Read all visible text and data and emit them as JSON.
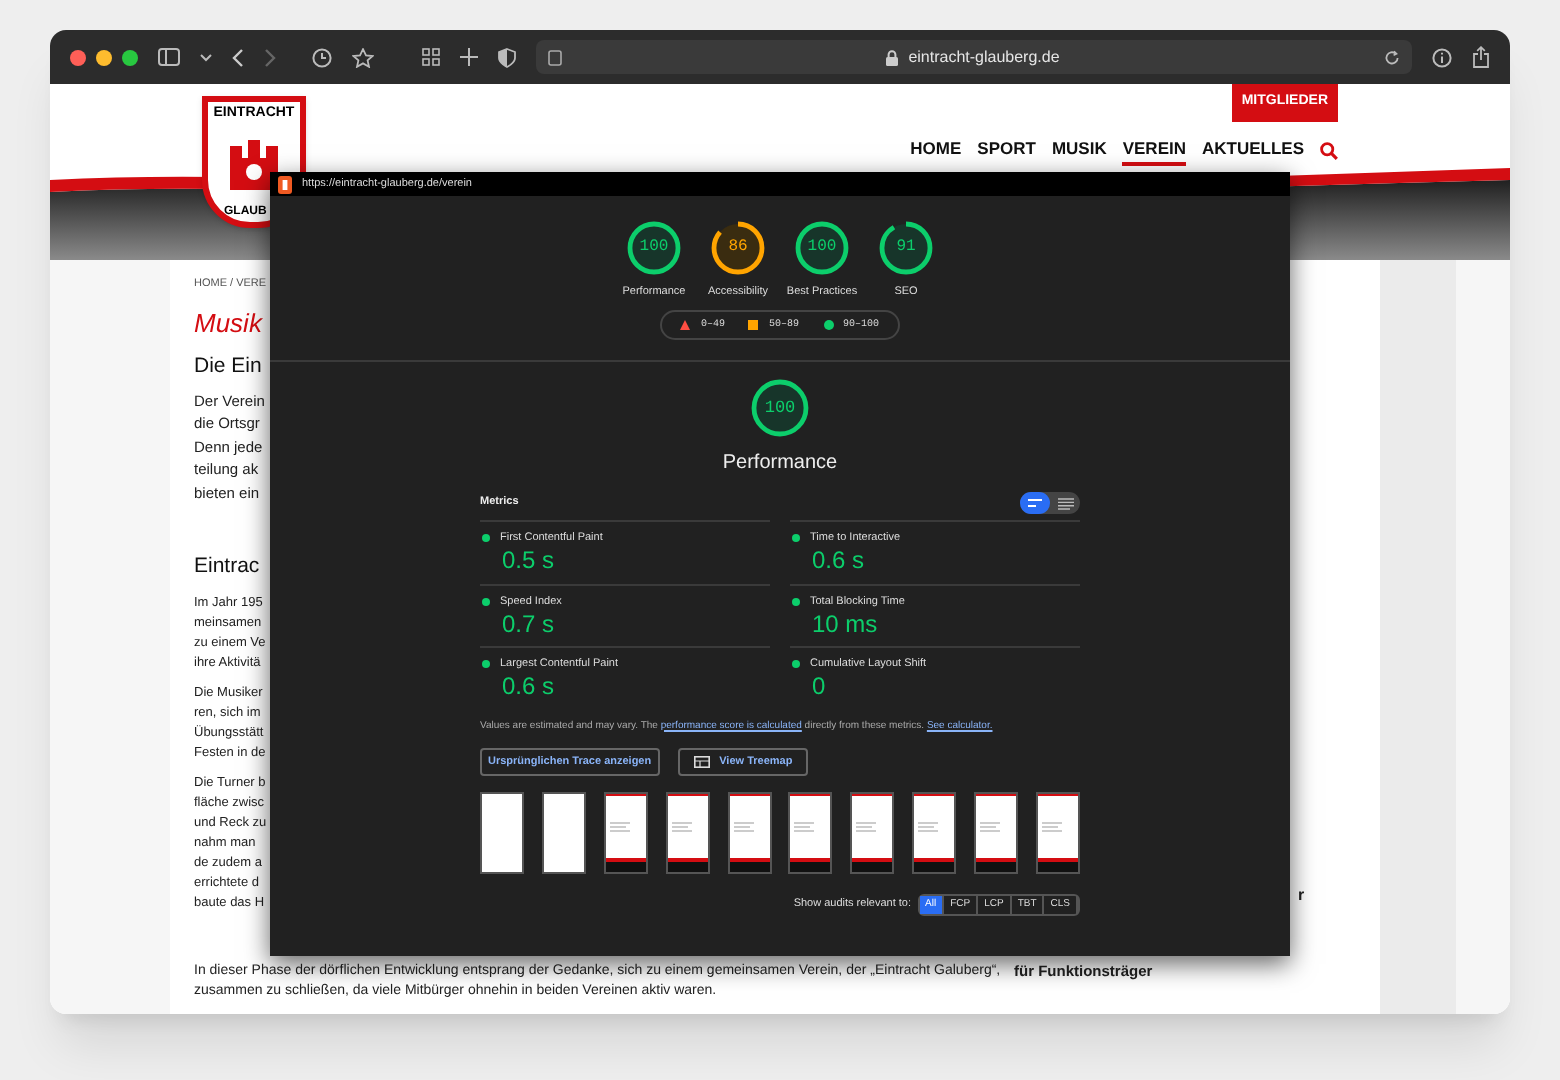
{
  "browser": {
    "url": "eintracht-glauberg.de"
  },
  "site": {
    "logo_top": "EINTRACHT",
    "logo_bottom": "GLAUB",
    "member_button": "MITGLIEDER",
    "nav": [
      {
        "label": "HOME",
        "selected": false
      },
      {
        "label": "SPORT",
        "selected": false
      },
      {
        "label": "MUSIK",
        "selected": false
      },
      {
        "label": "VEREIN",
        "selected": true
      },
      {
        "label": "AKTUELLES",
        "selected": false
      }
    ],
    "breadcrumb": "HOME / VERE",
    "page_title": "Musik",
    "heading": "Die Ein",
    "intro": [
      "Der Verein",
      "die Ortsgr",
      "Denn jede",
      "teilung ak",
      "bieten ein"
    ],
    "section_heading": "Eintrac",
    "paragraphs": [
      [
        "Im Jahr 195",
        "meinsamen",
        "zu einem Ve",
        "ihre Aktivitä"
      ],
      [
        "Die Musiker",
        "ren, sich im",
        "Übungsstätt",
        "Festen in de"
      ],
      [
        "Die Turner b",
        "fläche zwisc",
        "und Reck zu",
        "nahm man",
        "de zudem a",
        "errichtete d",
        "baute das H"
      ]
    ],
    "bottom_paragraph": "In dieser Phase der dörflichen Entwicklung entsprang der Gedanke, sich zu einem gemeinsamen Verein, der „Eintracht Galuberg“, zusammen zu schließen, da viele Mitbürger ohnehin in beiden Vereinen aktiv waren.",
    "side_fragment": "r",
    "side_heading": "für Funktionsträger"
  },
  "lighthouse": {
    "url": "https://eintracht-glauberg.de/verein",
    "gauges": [
      {
        "score": "100",
        "label": "Performance"
      },
      {
        "score": "86",
        "label": "Accessibility"
      },
      {
        "score": "100",
        "label": "Best Practices"
      },
      {
        "score": "91",
        "label": "SEO"
      }
    ],
    "legend": [
      {
        "kind": "fail",
        "label": "0–49"
      },
      {
        "kind": "average",
        "label": "50–89"
      },
      {
        "kind": "pass",
        "label": "90–100"
      }
    ],
    "main_gauge": {
      "score": "100",
      "label": "Performance"
    },
    "metrics_title": "Metrics",
    "view_toggle": [
      {
        "kind": "bars",
        "selected": true
      },
      {
        "kind": "list",
        "selected": false
      }
    ],
    "metrics": [
      {
        "name": "First Contentful Paint",
        "value": "0.5 s"
      },
      {
        "name": "Time to Interactive",
        "value": "0.6 s"
      },
      {
        "name": "Speed Index",
        "value": "0.7 s"
      },
      {
        "name": "Total Blocking Time",
        "value": "10 ms"
      },
      {
        "name": "Largest Contentful Paint",
        "value": "0.6 s"
      },
      {
        "name": "Cumulative Layout Shift",
        "value": "0"
      }
    ],
    "note": {
      "before": "Values are estimated and may vary. The ",
      "link1": "performance score is calculated",
      "middle": " directly from these metrics. ",
      "link2": "See calculator."
    },
    "buttons": [
      {
        "kind": "plain",
        "label": "Ursprünglichen Trace anzeigen"
      },
      {
        "kind": "treemap",
        "label": "View Treemap"
      }
    ],
    "filmstrip": [
      {
        "kind": "blank"
      },
      {
        "kind": "blank"
      },
      {
        "kind": "page"
      },
      {
        "kind": "page"
      },
      {
        "kind": "page"
      },
      {
        "kind": "page"
      },
      {
        "kind": "page"
      },
      {
        "kind": "page"
      },
      {
        "kind": "page"
      },
      {
        "kind": "page"
      }
    ],
    "filter_label": "Show audits relevant to:",
    "filters": [
      {
        "label": "All",
        "selected": true
      },
      {
        "label": "FCP",
        "selected": false
      },
      {
        "label": "LCP",
        "selected": false
      },
      {
        "label": "TBT",
        "selected": false
      },
      {
        "label": "CLS",
        "selected": false
      }
    ]
  }
}
